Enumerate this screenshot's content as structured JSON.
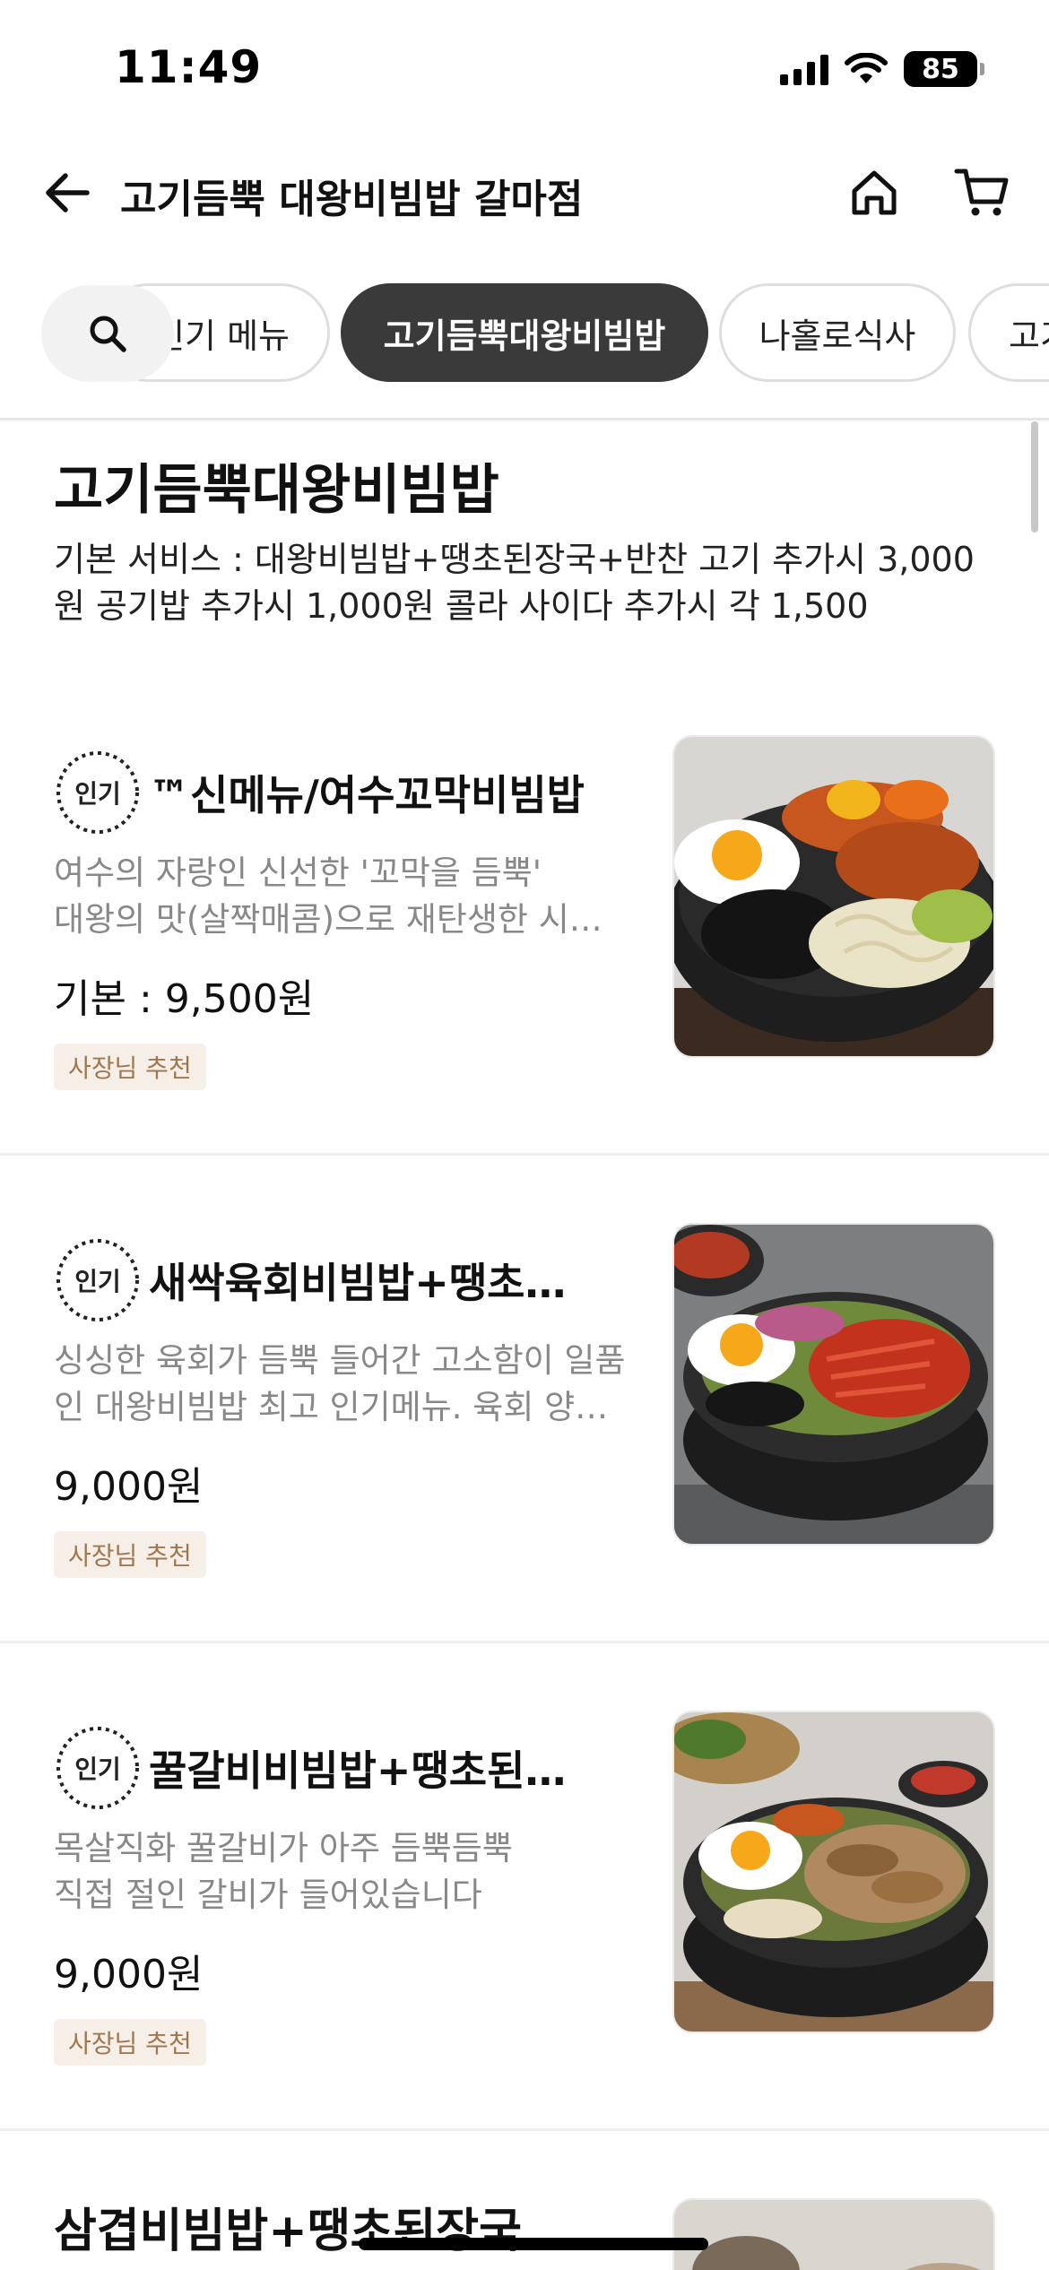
{
  "status_bar": {
    "time": "11:49",
    "battery": "85"
  },
  "header": {
    "title": "고기듬뿍 대왕비빔밥 갈마점"
  },
  "tabs": [
    {
      "label": "인기 메뉴",
      "active": false
    },
    {
      "label": "고기듬뿍대왕비빔밥",
      "active": true
    },
    {
      "label": "나홀로식사",
      "active": false
    },
    {
      "label": "고기",
      "active": false
    }
  ],
  "section": {
    "title": "고기듬뿍대왕비빔밥",
    "description": "기본 서비스 : 대왕비빔밥+땡초된장국+반찬 고기 추가시 3,000원 공기밥 추가시 1,000원 콜라  사이다 추가시 각 1,500"
  },
  "popular_badge_label": "인기",
  "menu_items": [
    {
      "name": "™신메뉴/여수꼬막비빔밥",
      "desc_line1": "여수의 자랑인 신선한 '꼬막을 듬뿍'",
      "desc_line2": "대왕의 맛(살짝매콤)으로 재탄생한 시…",
      "price": "기본 : 9,500원",
      "badge": "사장님 추천"
    },
    {
      "name": "새싹육회비빔밥+땡초…",
      "desc_line1": "싱싱한 육회가 듬뿍 들어간 고소함이 일품",
      "desc_line2": "인 대왕비빔밥 최고 인기메뉴. 육회 양…",
      "price": "9,000원",
      "badge": "사장님 추천"
    },
    {
      "name": "꿀갈비비빔밥+땡초된…",
      "desc_line1": "목살직화 꿀갈비가 아주 듬뿍듬뿍",
      "desc_line2": "직접 절인 갈비가 들어있습니다",
      "price": "9,000원",
      "badge": "사장님 추천"
    }
  ],
  "next_item": {
    "name": "삼겹비빔밥+땡초된장국"
  },
  "colors": {
    "active_tab": "#3a3a3a",
    "badge_bg": "#f5efe8",
    "badge_text": "#a07850",
    "desc_text": "#888888"
  }
}
